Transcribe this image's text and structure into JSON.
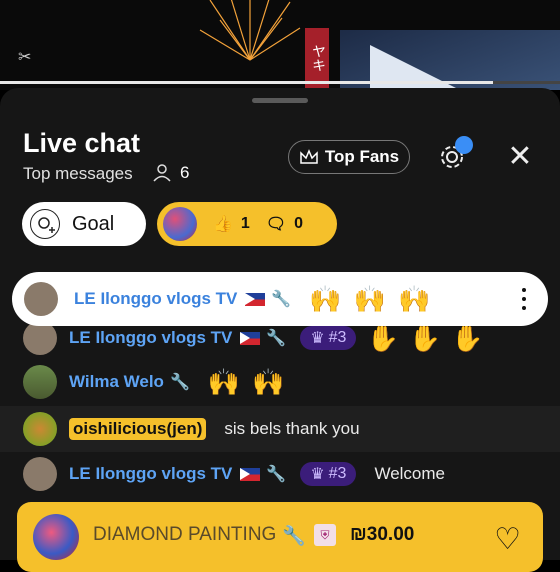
{
  "video": {
    "banner_text": "ヤキ",
    "progress": 0.88
  },
  "header": {
    "title": "Live chat",
    "subtitle": "Top messages",
    "viewer_count": "6",
    "top_fans_label": "Top Fans"
  },
  "chips": {
    "goal_label": "Goal",
    "likes": "1",
    "comments": "0"
  },
  "messages": [
    {
      "name": "LE Ilonggo vlogs TV",
      "badge": "",
      "text": ""
    },
    {
      "name": "LE Ilonggo vlogs TV",
      "badge": "#3",
      "text": ""
    },
    {
      "name": "Wilma Welo",
      "badge": "",
      "text": ""
    },
    {
      "name": "oishilicious(jen)",
      "badge": "",
      "text": "sis bels thank you"
    },
    {
      "name": "LE Ilonggo vlogs TV",
      "badge": "#3",
      "text": "Welcome"
    }
  ],
  "superchat": {
    "name": "DIAMOND PAINTING",
    "amount": "₪30.00"
  },
  "colors": {
    "accent_yellow": "#f5c02b",
    "name_blue": "#5ea4f5",
    "badge_purple": "#3b1d7a",
    "notif_blue": "#3a8ef6"
  }
}
